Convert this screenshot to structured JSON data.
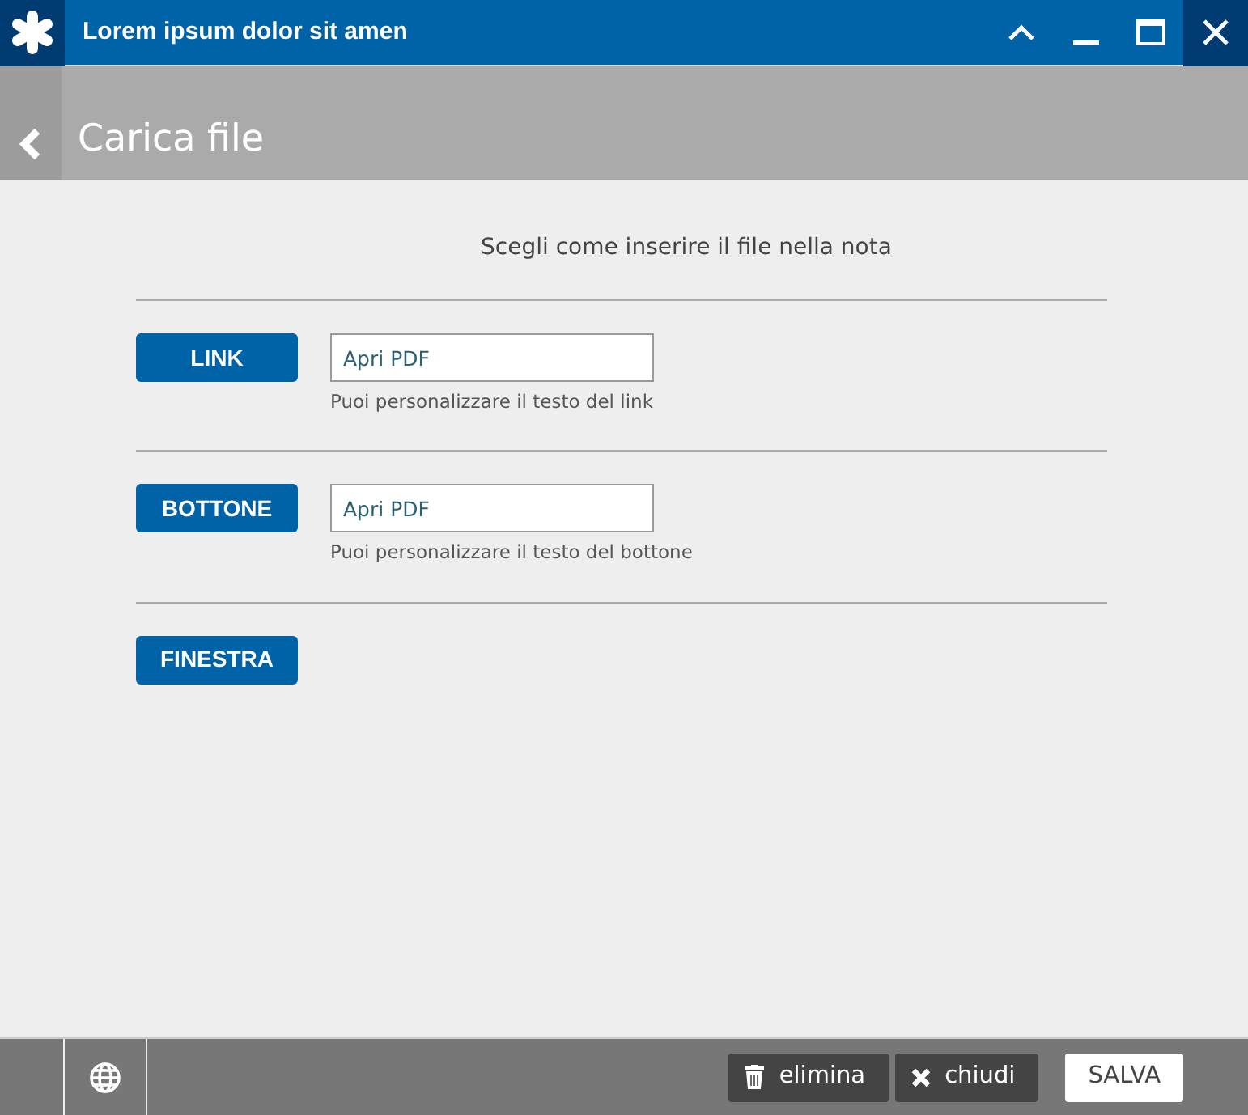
{
  "window": {
    "title": "Lorem ipsum dolor sit amen"
  },
  "header": {
    "title": "Carica file"
  },
  "intro": "Scegli come inserire il file nella nota",
  "options": [
    {
      "kind": "field",
      "label": "LINK",
      "value": "Apri PDF",
      "hint": "Puoi personalizzare il testo del link"
    },
    {
      "kind": "field",
      "label": "BOTTONE",
      "value": "Apri PDF",
      "hint": "Puoi personalizzare il testo del bottone"
    },
    {
      "kind": "plain",
      "label": "FINESTRA"
    }
  ],
  "footer": {
    "buttons": [
      {
        "kind": "delete",
        "label": "elimina"
      },
      {
        "kind": "close",
        "label": "chiudi"
      },
      {
        "kind": "save",
        "label": "SALVA"
      }
    ]
  }
}
